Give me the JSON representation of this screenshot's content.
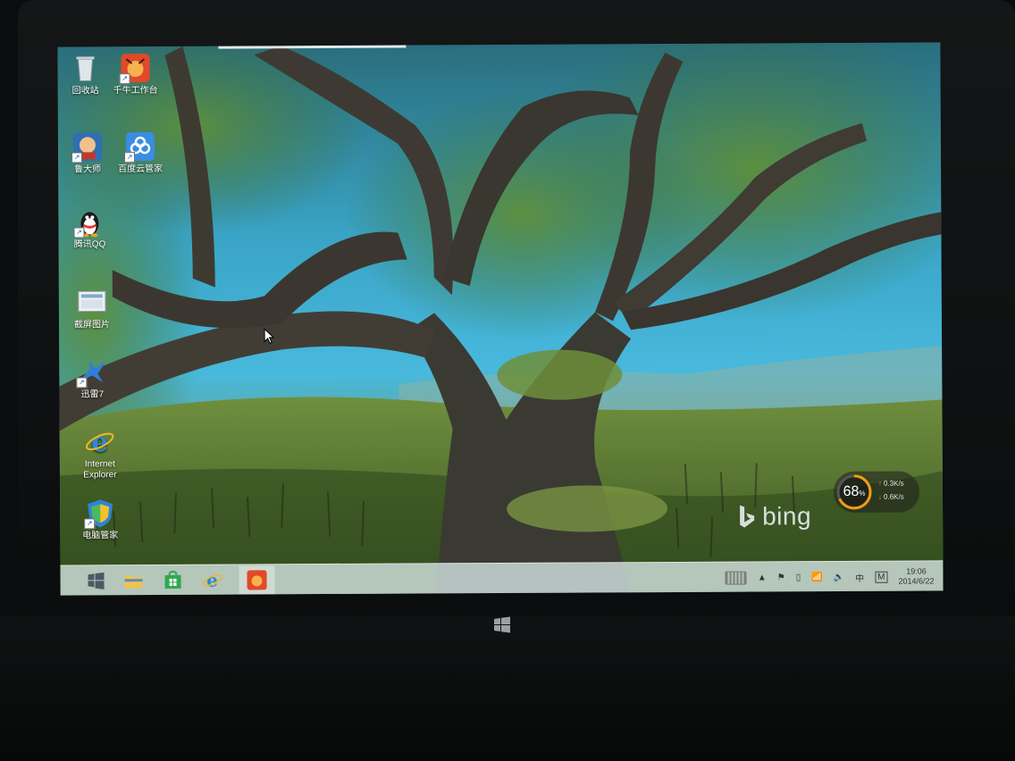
{
  "desktop_icons": [
    {
      "id": "recycle",
      "label": "回收站",
      "icon": "recycle-bin-icon"
    },
    {
      "id": "qianniu",
      "label": "千牛工作台",
      "icon": "qianniu-icon"
    },
    {
      "id": "ludashi",
      "label": "鲁大师",
      "icon": "ludashi-icon"
    },
    {
      "id": "baiduyun",
      "label": "百度云管家",
      "icon": "baidu-cloud-icon"
    },
    {
      "id": "qq",
      "label": "腾讯QQ",
      "icon": "qq-penguin-icon"
    },
    {
      "id": "screenshot",
      "label": "截屏图片",
      "icon": "screenshot-folder-icon"
    },
    {
      "id": "xunlei",
      "label": "迅雷7",
      "icon": "xunlei-bird-icon"
    },
    {
      "id": "ie",
      "label": "Internet Explorer",
      "icon": "internet-explorer-icon"
    },
    {
      "id": "pcmgr",
      "label": "电脑管家",
      "icon": "pc-manager-shield-icon"
    }
  ],
  "wallpaper_brand": "bing",
  "network_widget": {
    "percent": "68",
    "percent_unit": "%",
    "upload": "0.3K/s",
    "download": "0.6K/s",
    "level": 0.68
  },
  "taskbar": {
    "buttons": [
      {
        "id": "start",
        "icon": "windows-start-icon"
      },
      {
        "id": "explorer",
        "icon": "file-explorer-folder-icon"
      },
      {
        "id": "store",
        "icon": "windows-store-icon"
      },
      {
        "id": "ie",
        "icon": "internet-explorer-icon"
      },
      {
        "id": "qianniu",
        "icon": "qianniu-icon"
      }
    ],
    "tray": {
      "up_arrow": "▲",
      "ime_lang": "中",
      "ime_mode": "M",
      "time": "19:06",
      "date": "2014/6/22"
    }
  },
  "colors": {
    "taskbar_bg": "#d2e1de",
    "accent_orange": "#f39c12"
  }
}
